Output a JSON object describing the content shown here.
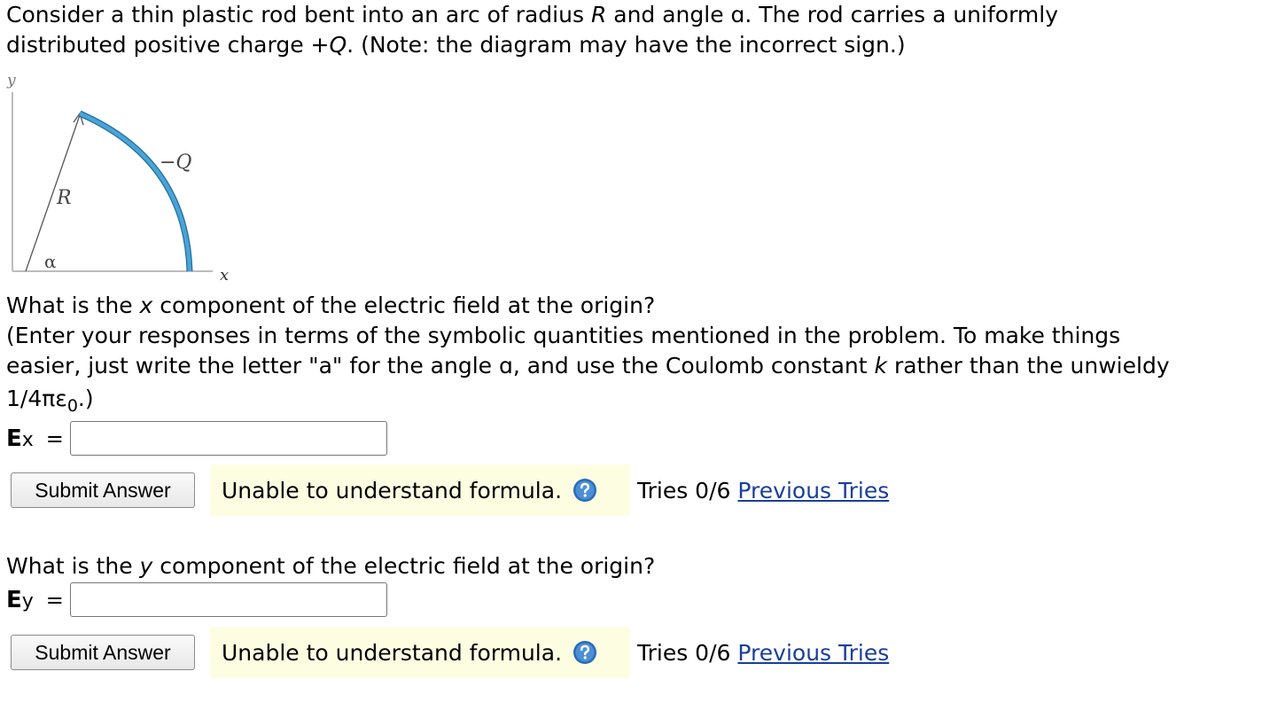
{
  "problem": {
    "intro_1a": "Consider a thin plastic rod bent into an arc of radius ",
    "intro_1_R": "R",
    "intro_1b": " and angle ɑ. The rod carries a uniformly",
    "intro_2a": "distributed positive charge +",
    "intro_2_Q": "Q",
    "intro_2b": ". (Note: the diagram may have the incorrect sign.)"
  },
  "diagram": {
    "y_axis_label": "y",
    "x_axis_label": "x",
    "radius_label": "R",
    "angle_label": "α",
    "charge_label": "−Q",
    "colors": {
      "rod": "#2e8ec6",
      "axes": "#bdbdbd",
      "radius_line": "#555555"
    }
  },
  "question_x": {
    "q_a": "What is the ",
    "q_var": "x",
    "q_b": " component of the electric field at the origin?",
    "instr_1": "(Enter your responses in terms of the symbolic quantities mentioned in the problem. To make things",
    "instr_2a": "easier, just write the letter \"a\" for the angle ɑ, and use the Coulomb constant ",
    "instr_2_k": "k",
    "instr_2b": " rather than the unwieldy",
    "instr_3a": "1/4πε",
    "instr_3_sub": "0",
    "instr_3b": ".)",
    "label_main": "E",
    "label_sub": "x",
    "equals": "=",
    "input_value": "",
    "submit_label": "Submit Answer",
    "feedback": "Unable to understand formula.",
    "help_icon": "question-circle-icon",
    "tries": "Tries 0/6",
    "previous_tries": "Previous Tries"
  },
  "question_y": {
    "q_a": "What is the ",
    "q_var": "y",
    "q_b": " component of the electric field at the origin?",
    "label_main": "E",
    "label_sub": "y",
    "equals": "=",
    "input_value": "",
    "submit_label": "Submit Answer",
    "feedback": "Unable to understand formula.",
    "help_icon": "question-circle-icon",
    "tries": "Tries 0/6",
    "previous_tries": "Previous Tries"
  },
  "colors": {
    "link": "#1a3e9a",
    "feedback_bg": "#fdfde2",
    "help_icon": "#2a6bb5"
  }
}
